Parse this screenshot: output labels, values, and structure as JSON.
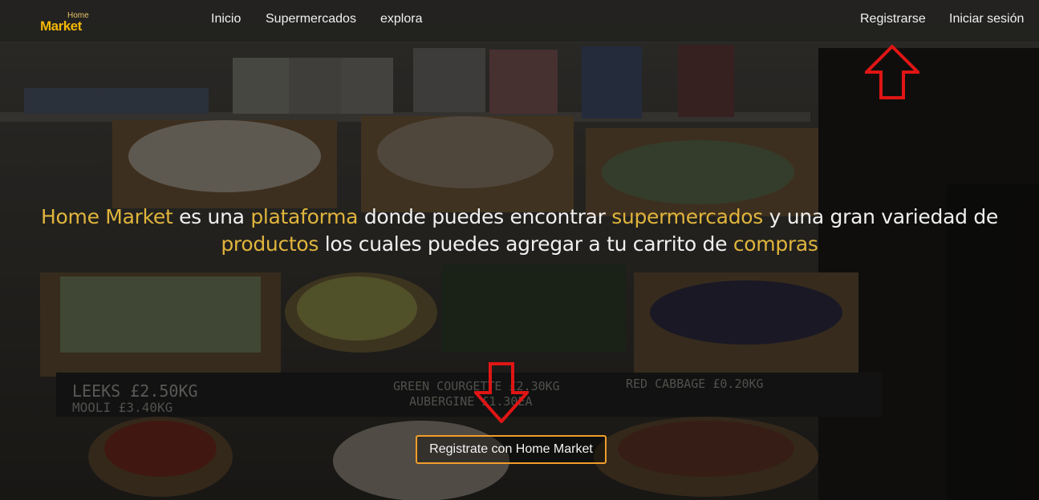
{
  "nav": {
    "logo_small": "Home",
    "logo_big": "Market",
    "links": [
      "Inicio",
      "Supermercados",
      "explora"
    ],
    "register_label": "Registrarse",
    "login_label": "Iniciar sesión"
  },
  "hero": {
    "p1_accent": "Home Market",
    "p2": " es una ",
    "p3_accent": "plataforma",
    "p4": " donde puedes encontrar ",
    "p5_accent": "supermercados",
    "p6": " y una gran variedad de ",
    "p7_accent": "productos",
    "p8": " los cuales puedes agregar a tu carrito de ",
    "p9_accent": "compras"
  },
  "cta": {
    "label": "Registrate con Home Market"
  },
  "chalkboard": {
    "text1": "LEEKS £2.50KG",
    "text2": "MOOLI £3.40KG",
    "text3": "GREEN COURGETTE £2.30KG",
    "text4": "RED CABBAGE £0.20KG",
    "text5": "AUBERGINE £1.30EA"
  },
  "colors": {
    "accent": "#e0b43c",
    "logo": "#f2b705",
    "button_border": "#f29d2a",
    "annotation_arrow": "#e01515"
  }
}
